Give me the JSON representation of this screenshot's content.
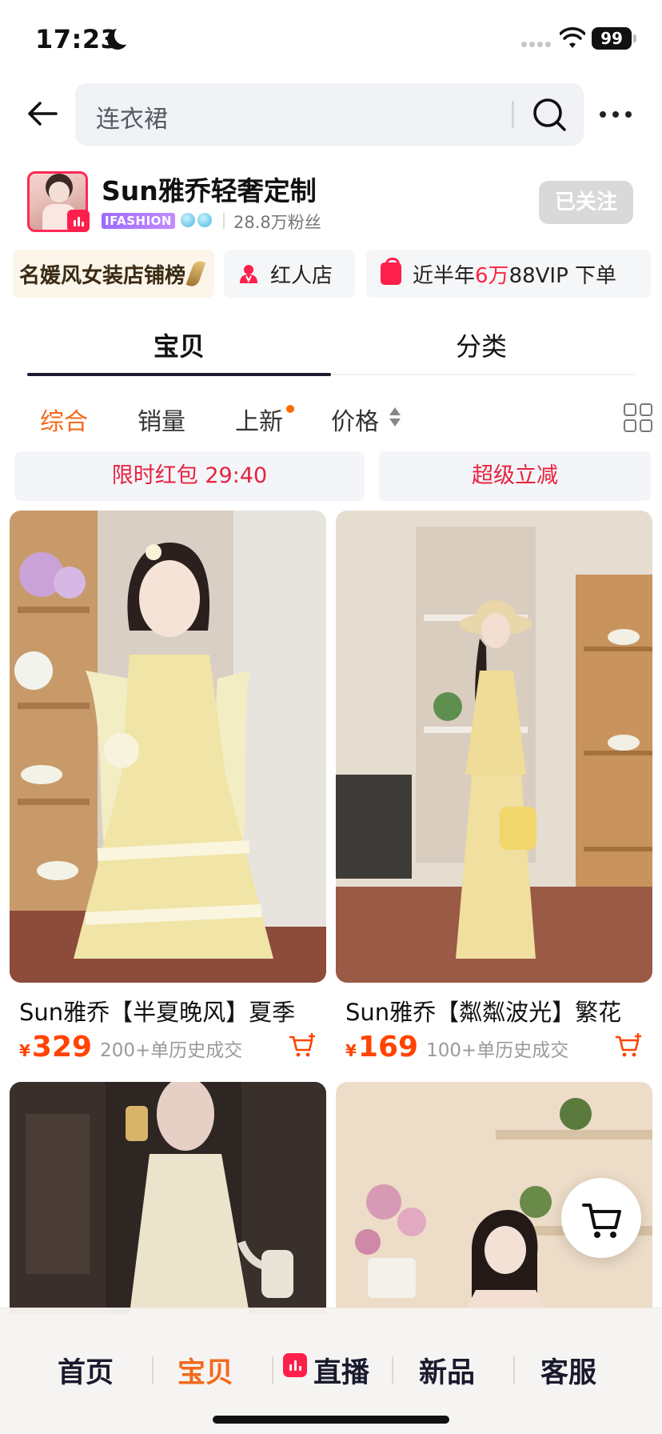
{
  "status_bar": {
    "time": "17:23",
    "battery": "99"
  },
  "search": {
    "query": "连衣裙"
  },
  "shop": {
    "name": "Sun雅乔轻奢定制",
    "brand_tag": "IFASHION",
    "fans": "28.8万粉丝",
    "follow_label": "已关注"
  },
  "chips": {
    "rank": "名媛风女装店铺榜",
    "red_store": "红人店",
    "vip_prefix": "近半年",
    "vip_highlight": "6万",
    "vip_suffix": "88VIP 下单"
  },
  "tabs": [
    {
      "label": "宝贝"
    },
    {
      "label": "分类"
    }
  ],
  "sort": [
    {
      "label": "综合"
    },
    {
      "label": "销量"
    },
    {
      "label": "上新"
    },
    {
      "label": "价格"
    }
  ],
  "promos": {
    "red_packet": "限时红包  29:40",
    "instant_discount": "超级立减"
  },
  "products": [
    {
      "title": "Sun雅乔【半夏晚风】夏季",
      "currency": "¥",
      "price": "329",
      "sold": "200+单历史成交"
    },
    {
      "title": "Sun雅乔【粼粼波光】繁花",
      "currency": "¥",
      "price": "169",
      "sold": "100+单历史成交"
    }
  ],
  "bottom_nav": [
    {
      "label": "首页"
    },
    {
      "label": "宝贝"
    },
    {
      "label": "直播"
    },
    {
      "label": "新品"
    },
    {
      "label": "客服"
    }
  ],
  "colors": {
    "accent_orange": "#f26a1b",
    "price_red": "#ff4400",
    "brand_red": "#ff1f4b",
    "promo_red": "#e8223f"
  },
  "icons": [
    "moon-icon",
    "wifi-icon",
    "battery-icon",
    "back-arrow-icon",
    "search-icon",
    "more-icon",
    "person-icon",
    "shopping-bag-icon",
    "feather-icon",
    "sort-arrows-icon",
    "grid-view-icon",
    "add-to-cart-icon",
    "cart-icon",
    "live-icon"
  ]
}
